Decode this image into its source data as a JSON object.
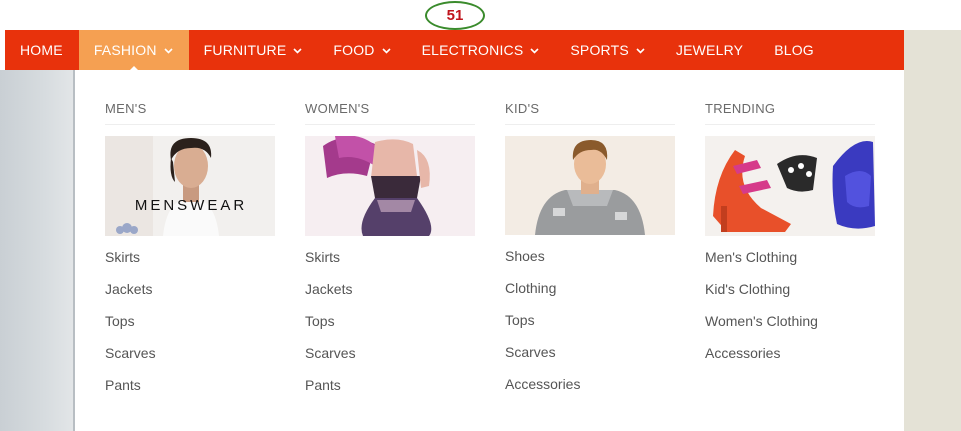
{
  "badge": {
    "label": "51"
  },
  "nav": {
    "items": [
      {
        "label": "HOME",
        "has_dropdown": false,
        "active": false
      },
      {
        "label": "FASHION",
        "has_dropdown": true,
        "active": true
      },
      {
        "label": "FURNITURE",
        "has_dropdown": true,
        "active": false
      },
      {
        "label": "FOOD",
        "has_dropdown": true,
        "active": false
      },
      {
        "label": "ELECTRONICS",
        "has_dropdown": true,
        "active": false
      },
      {
        "label": "SPORTS",
        "has_dropdown": true,
        "active": false
      },
      {
        "label": "JEWELRY",
        "has_dropdown": false,
        "active": false
      },
      {
        "label": "BLOG",
        "has_dropdown": false,
        "active": false
      }
    ]
  },
  "dropdown": {
    "columns": [
      {
        "title": "MEN'S",
        "image_text": "MENSWEAR",
        "links": [
          "Skirts",
          "Jackets",
          "Tops",
          "Scarves",
          "Pants"
        ]
      },
      {
        "title": "WOMEN'S",
        "links": [
          "Skirts",
          "Jackets",
          "Tops",
          "Scarves",
          "Pants"
        ]
      },
      {
        "title": "KID'S",
        "links": [
          "Shoes",
          "Clothing",
          "Tops",
          "Scarves",
          "Accessories"
        ]
      },
      {
        "title": "TRENDING",
        "links": [
          "Men's Clothing",
          "Kid's Clothing",
          "Women's Clothing",
          "Accessories"
        ]
      }
    ]
  },
  "colors": {
    "nav_bg": "#e8320c",
    "nav_active_bg": "#f5a052",
    "badge_ring": "#3a8b2c",
    "badge_text": "#c0141c"
  }
}
